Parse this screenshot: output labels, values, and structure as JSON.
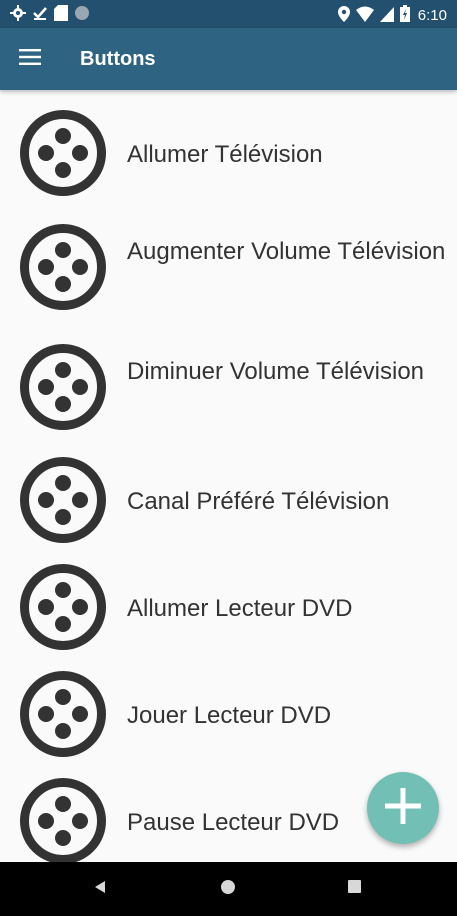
{
  "status_bar": {
    "time": "6:10",
    "left_icons": [
      "gear-icon",
      "check-download-icon",
      "sd-card-icon",
      "circle-icon"
    ],
    "right_icons": [
      "location-icon",
      "wifi-icon",
      "signal-icon",
      "battery-icon"
    ]
  },
  "app_bar": {
    "title": "Buttons",
    "background": "#2e6482",
    "status_background": "#23506e"
  },
  "buttons": [
    {
      "label": "Allumer Télévision",
      "icon": "button-dots-icon"
    },
    {
      "label": "Augmenter Volume Télévision",
      "icon": "button-dots-icon"
    },
    {
      "label": "Diminuer Volume Télévision",
      "icon": "button-dots-icon"
    },
    {
      "label": "Canal Préféré Télévision",
      "icon": "button-dots-icon"
    },
    {
      "label": "Allumer Lecteur DVD",
      "icon": "button-dots-icon"
    },
    {
      "label": "Jouer Lecteur DVD",
      "icon": "button-dots-icon"
    },
    {
      "label": "Pause Lecteur DVD",
      "icon": "button-dots-icon"
    }
  ],
  "fab": {
    "icon": "plus-icon",
    "color": "#72bfb5"
  },
  "nav_bar": {
    "buttons": [
      "back-icon",
      "home-icon",
      "recents-icon"
    ]
  }
}
